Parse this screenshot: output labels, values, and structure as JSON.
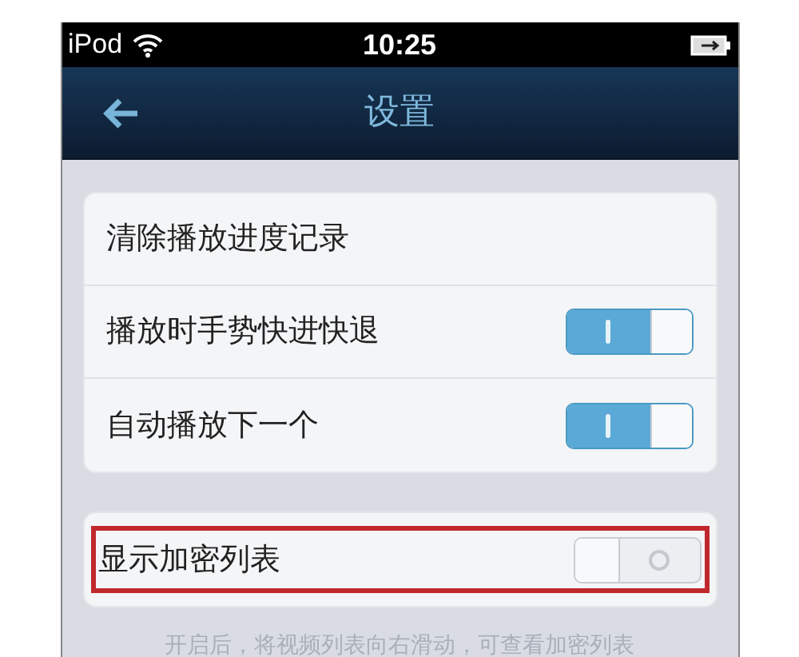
{
  "status_bar": {
    "carrier": "iPod",
    "time": "10:25"
  },
  "nav_bar": {
    "title": "设置"
  },
  "groups": [
    {
      "rows": [
        {
          "kind": "action",
          "label": "清除播放进度记录",
          "highlighted": false
        },
        {
          "kind": "toggle",
          "label": "播放时手势快进快退",
          "on": true,
          "highlighted": false
        },
        {
          "kind": "toggle",
          "label": "自动播放下一个",
          "on": true,
          "highlighted": false
        }
      ]
    },
    {
      "rows": [
        {
          "kind": "toggle",
          "label": "显示加密列表",
          "on": false,
          "highlighted": true
        }
      ]
    }
  ],
  "footer_note": "开启后，将视频列表向右滑动，可查看加密列表"
}
